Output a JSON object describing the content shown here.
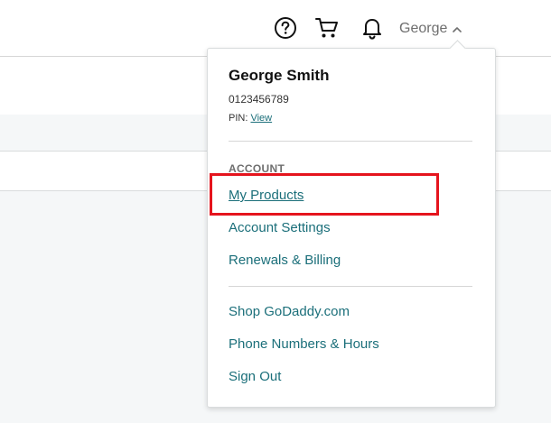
{
  "header": {
    "help_icon": "help-circle-icon",
    "cart_icon": "shopping-cart-icon",
    "bell_icon": "bell-icon",
    "user_label": "George",
    "user_chevron": "chevron-up-icon"
  },
  "account_menu": {
    "full_name": "George Smith",
    "customer_number": "0123456789",
    "pin_label": "PIN:",
    "pin_link": "View",
    "section_heading": "ACCOUNT",
    "account_items": [
      {
        "label": "My Products"
      },
      {
        "label": "Account Settings"
      },
      {
        "label": "Renewals & Billing"
      }
    ],
    "other_items": [
      {
        "label": "Shop GoDaddy.com"
      },
      {
        "label": "Phone Numbers & Hours"
      },
      {
        "label": "Sign Out"
      }
    ]
  },
  "colors": {
    "link": "#1b6f7a",
    "highlight": "#e5141d",
    "page_bg": "#f5f7f8"
  }
}
